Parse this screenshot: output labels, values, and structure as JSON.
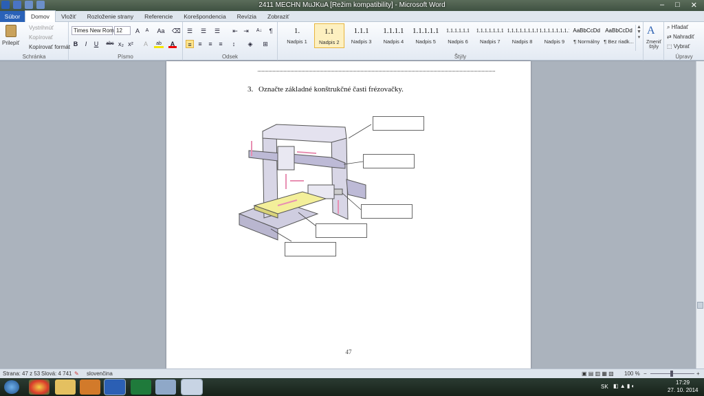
{
  "window": {
    "title": "2411 MECHN MuJKuA [Režim kompatibility] - Microsoft Word",
    "minimize": "–",
    "maximize": "□",
    "close": "✕"
  },
  "tabs": [
    "Súbor",
    "Domov",
    "Vložiť",
    "Rozloženie strany",
    "Referencie",
    "Korešpondencia",
    "Revízia",
    "Zobraziť"
  ],
  "clipboard": {
    "paste": "Prilepiť",
    "cut": "Vystrihnúť",
    "copy": "Kopírovať",
    "format_painter": "Kopírovať formát",
    "group": "Schránka"
  },
  "font": {
    "name": "Times New Rom.",
    "size": "12",
    "grow": "A",
    "shrink": "A",
    "change_case": "Aa",
    "bold": "B",
    "italic": "I",
    "underline": "U",
    "strike": "abc",
    "subscript": "x₂",
    "superscript": "x²",
    "highlight": "ab",
    "color": "A",
    "group": "Písmo"
  },
  "paragraph": {
    "group": "Odsek",
    "sort": "A↓",
    "show_marks": "¶"
  },
  "styles": {
    "group": "Štýly",
    "items": [
      {
        "preview": "1.",
        "name": "Nadpis 1"
      },
      {
        "preview": "1.1",
        "name": "Nadpis 2"
      },
      {
        "preview": "1.1.1",
        "name": "Nadpis 3"
      },
      {
        "preview": "1.1.1.1",
        "name": "Nadpis 4"
      },
      {
        "preview": "1.1.1.1.1",
        "name": "Nadpis 5"
      },
      {
        "preview": "1.1.1.1.1.1",
        "name": "Nadpis 6"
      },
      {
        "preview": "1.1.1.1.1.1.1",
        "name": "Nadpis 7"
      },
      {
        "preview": "1.1.1.1.1.1.1.1",
        "name": "Nadpis 8"
      },
      {
        "preview": "1.1.1.1.1.1.1.1.1",
        "name": "Nadpis 9"
      },
      {
        "preview": "AaBbCcDd",
        "name": "¶ Normálny"
      },
      {
        "preview": "AaBbCcDd",
        "name": "¶ Bez riadk..."
      }
    ],
    "change": "Zmeniť štýly"
  },
  "editing": {
    "group": "Úpravy",
    "find": "Hľadať",
    "replace": "Nahradiť",
    "select": "Vybrať"
  },
  "document": {
    "question_number": "3.",
    "question_text": "Označte základné konštrukčné časti frézovačky.",
    "page_number": "47"
  },
  "status": {
    "page": "Strana: 47 z 53",
    "words": "Slová: 4 741",
    "language": "slovenčina",
    "zoom": "100 %",
    "zoom_minus": "−",
    "zoom_plus": "+"
  },
  "taskbar": {
    "lang": "SK",
    "time": "17:29",
    "date": "27. 10. 2014"
  },
  "colors": {
    "file_tab": "#2a62b8",
    "machine_table": "#f3ef9a",
    "arrow": "#f2b9cf",
    "machine_body": "#d8d6e6"
  }
}
